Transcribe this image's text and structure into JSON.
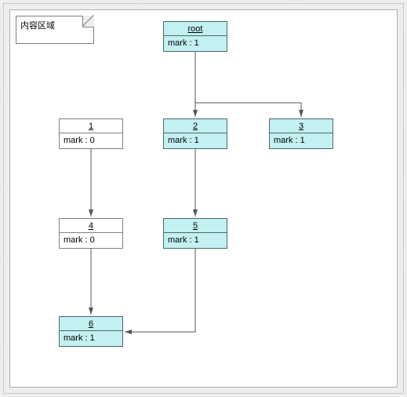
{
  "note": {
    "label": "内容区域"
  },
  "nodes": {
    "root": {
      "title": "root",
      "attr": "mark : 1"
    },
    "n1": {
      "title": "1",
      "attr": "mark : 0"
    },
    "n2": {
      "title": "2",
      "attr": "mark : 1"
    },
    "n3": {
      "title": "3",
      "attr": "mark : 1"
    },
    "n4": {
      "title": "4",
      "attr": "mark : 0"
    },
    "n5": {
      "title": "5",
      "attr": "mark : 1"
    },
    "n6": {
      "title": "6",
      "attr": "mark : 1"
    }
  },
  "edges": [
    {
      "from": "root",
      "to": "n2"
    },
    {
      "from": "root",
      "to": "n3"
    },
    {
      "from": "n1",
      "to": "n4"
    },
    {
      "from": "n2",
      "to": "n5"
    },
    {
      "from": "n4",
      "to": "n6"
    },
    {
      "from": "n5",
      "to": "n6"
    }
  ]
}
